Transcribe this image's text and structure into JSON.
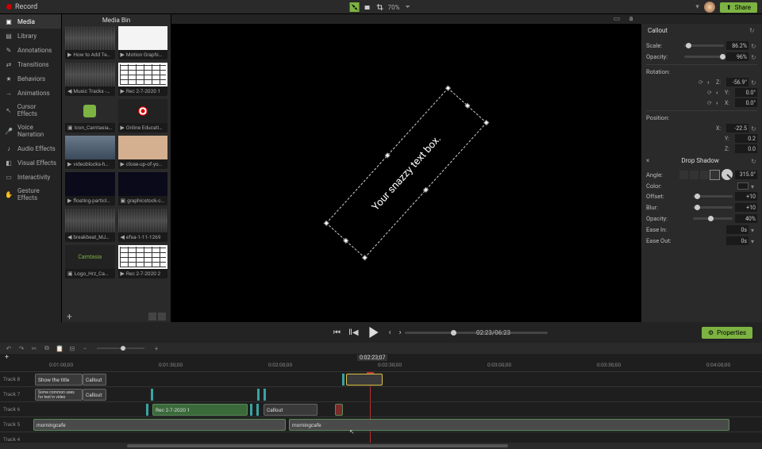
{
  "top": {
    "record": "Record",
    "zoom": "70%",
    "share": "Share"
  },
  "rail": {
    "media": "Media",
    "library": "Library",
    "annotations": "Annotations",
    "transitions": "Transitions",
    "behaviors": "Behaviors",
    "animations": "Animations",
    "cursor_effects": "Cursor Effects",
    "voice_narration": "Voice Narration",
    "audio_effects": "Audio Effects",
    "visual_effects": "Visual Effects",
    "interactivity": "Interactivity",
    "gesture_effects": "Gesture Effects"
  },
  "bin": {
    "title": "Media Bin",
    "items": [
      {
        "label": "How to Add Te…",
        "icon": "▶"
      },
      {
        "label": "Motion Graphi…",
        "icon": "▶"
      },
      {
        "label": "Music Tracks -…",
        "icon": "◀"
      },
      {
        "label": "Rec 2-7-2020 1",
        "icon": "▶"
      },
      {
        "label": "Icon_Camtasia…",
        "icon": "▣"
      },
      {
        "label": "Online Educati…",
        "icon": "▶"
      },
      {
        "label": "videoblocks-h…",
        "icon": "▶"
      },
      {
        "label": "close-up-of-yo…",
        "icon": "▶"
      },
      {
        "label": "floating-particl…",
        "icon": "▶"
      },
      {
        "label": "graphicstock-c…",
        "icon": "▣"
      },
      {
        "label": "breakbeat_MJ…",
        "icon": "◀"
      },
      {
        "label": "efsa-1-11-1269",
        "icon": "◀"
      },
      {
        "label": "Logo_Hrz_Ca…",
        "icon": "▣"
      },
      {
        "label": "Rec 2-7-2020 2",
        "icon": "▶"
      }
    ]
  },
  "canvas": {
    "callout_text": "Your snazzy text box."
  },
  "playback": {
    "timecode": "02:23/06:23"
  },
  "properties": {
    "button": "Properties",
    "section": "Callout",
    "scale": {
      "label": "Scale:",
      "value": "86.2%"
    },
    "opacity": {
      "label": "Opacity:",
      "value": "96%"
    },
    "rotation": {
      "label": "Rotation:",
      "z": "-56.9°",
      "y": "0.0°",
      "x": "0.0°"
    },
    "position": {
      "label": "Position:",
      "x": "-22.5",
      "y": "0.2",
      "z": "0.0"
    },
    "drop_shadow": {
      "title": "Drop Shadow",
      "angle": {
        "label": "Angle:",
        "value": "315.0°"
      },
      "color": {
        "label": "Color:"
      },
      "offset": {
        "label": "Offset:",
        "value": "+10"
      },
      "blur": {
        "label": "Blur:",
        "value": "+10"
      },
      "opacity": {
        "label": "Opacity:",
        "value": "40%"
      },
      "ease_in": {
        "label": "Ease In:",
        "value": "0s"
      },
      "ease_out": {
        "label": "Ease Out:",
        "value": "0s"
      }
    }
  },
  "timeline": {
    "current_tc": "0:02:23;07",
    "ticks": [
      "0:01:00;00",
      "0:01:30;00",
      "0:02:00;00",
      "0:02:30;00",
      "0:03:00;00",
      "0:03:30;00",
      "0:04:00;00"
    ],
    "tracks": {
      "t8": {
        "label": "Track 8",
        "show_title": "Show the title",
        "callout": "Callout"
      },
      "t7": {
        "label": "Track 7",
        "note": "Some common uses for text in video",
        "callout": "Callout"
      },
      "t6": {
        "label": "Track 6",
        "rec": "Rec 2-7-2020 1",
        "callout": "Callout"
      },
      "t5": {
        "label": "Track 5",
        "clip1": "morningcafe",
        "clip2": "morningcafe"
      },
      "t4": {
        "label": "Track 4"
      }
    }
  }
}
